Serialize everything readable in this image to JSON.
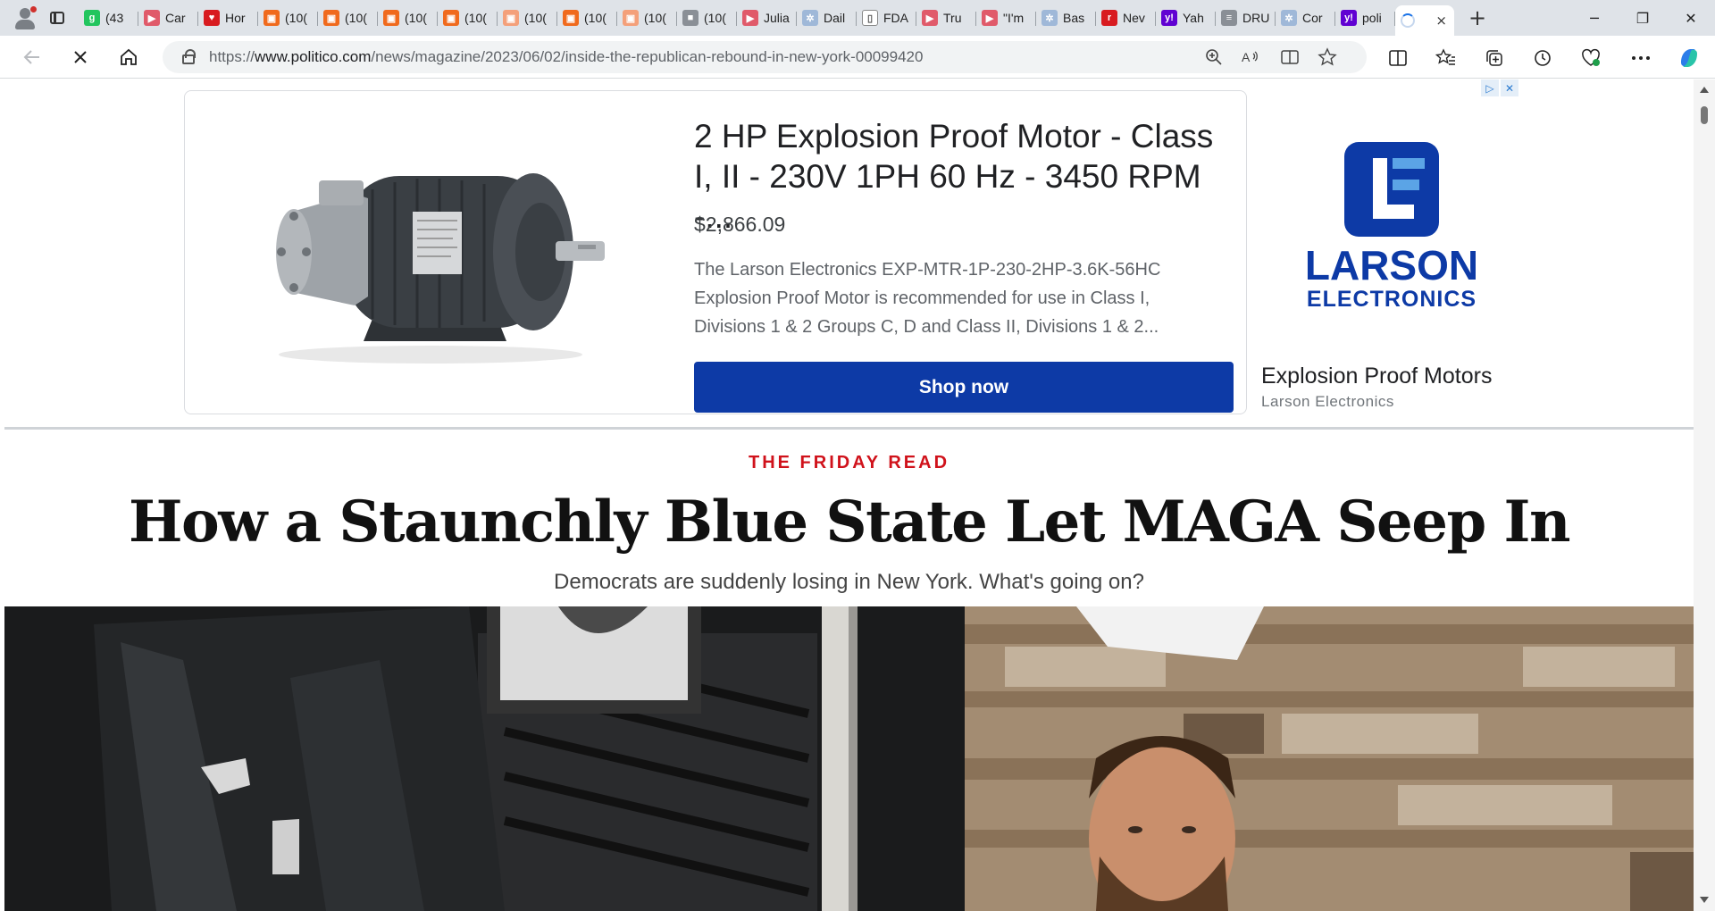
{
  "tabs": [
    {
      "label": "(43",
      "color": "#22c55e",
      "glyph": "g"
    },
    {
      "label": "Car",
      "color": "#e05a6a",
      "glyph": "▶"
    },
    {
      "label": "Hor",
      "color": "#d81b20",
      "glyph": "♥"
    },
    {
      "label": "(10(",
      "color": "#f06a1d",
      "glyph": "▣"
    },
    {
      "label": "(10(",
      "color": "#f06a1d",
      "glyph": "▣"
    },
    {
      "label": "(10(",
      "color": "#f06a1d",
      "glyph": "▣"
    },
    {
      "label": "(10(",
      "color": "#f06a1d",
      "glyph": "▣"
    },
    {
      "label": "(10(",
      "color": "#f4a07a",
      "glyph": "▣"
    },
    {
      "label": "(10(",
      "color": "#f06a1d",
      "glyph": "▣"
    },
    {
      "label": "(10(",
      "color": "#f4a07a",
      "glyph": "▣"
    },
    {
      "label": "(10(",
      "color": "#8a8f96",
      "glyph": "■"
    },
    {
      "label": "Julia",
      "color": "#e05a6a",
      "glyph": "▶"
    },
    {
      "label": "Dail",
      "color": "#9fb8d8",
      "glyph": "✲"
    },
    {
      "label": "FDA",
      "color": "#ffffff",
      "glyph": "▯"
    },
    {
      "label": "Tru",
      "color": "#e05a6a",
      "glyph": "▶"
    },
    {
      "label": "\"I'm",
      "color": "#e05a6a",
      "glyph": "▶"
    },
    {
      "label": "Bas",
      "color": "#9fb8d8",
      "glyph": "✲"
    },
    {
      "label": "Nev",
      "color": "#d81b20",
      "glyph": "r"
    },
    {
      "label": "Yah",
      "color": "#6001d2",
      "glyph": "y!"
    },
    {
      "label": "DRU",
      "color": "#8a8f96",
      "glyph": "≡"
    },
    {
      "label": "Cor",
      "color": "#9fb8d8",
      "glyph": "✲"
    },
    {
      "label": "poli",
      "color": "#6001d2",
      "glyph": "y!"
    }
  ],
  "active_tab": {
    "close": "×"
  },
  "window": {
    "minimize": "─",
    "maximize": "❐",
    "close": "✕",
    "new_tab": "+"
  },
  "address_bar": {
    "url_prefix": "https://",
    "url_host": "www.politico.com",
    "url_path": "/news/magazine/2023/06/02/inside-the-republican-rebound-in-new-york-00099420"
  },
  "ad": {
    "title": "2 HP Explosion Proof Motor - Class I, II - 230V 1PH 60 Hz - 3450 RPM -...",
    "price": "$2,866.09",
    "description": "The Larson Electronics EXP-MTR-1P-230-2HP-3.6K-56HC Explosion Proof Motor is recommended for use in Class I, Divisions 1 & 2 Groups C, D and Class II, Divisions 1 & 2...",
    "cta": "Shop now",
    "brand_line": "Explosion Proof Motors",
    "advertiser": "Larson Electronics",
    "logo_word1": "LARSON",
    "logo_word2": "ELECTRONICS",
    "logo_color": "#0d3aa6",
    "badge_info": "▷",
    "badge_close": "✕"
  },
  "article": {
    "kicker": "THE FRIDAY READ",
    "headline": "How a Staunchly Blue State Let MAGA Seep In",
    "dek": "Democrats are suddenly losing in New York. What's going on?",
    "kicker_color": "#d0121b"
  }
}
